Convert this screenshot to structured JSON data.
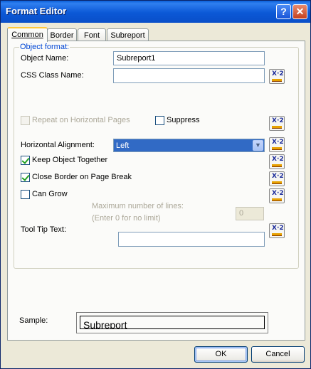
{
  "window": {
    "title": "Format Editor",
    "help_label": "?",
    "close_label": "✕"
  },
  "tabs": [
    {
      "label": "Common",
      "active": true
    },
    {
      "label": "Border",
      "active": false
    },
    {
      "label": "Font",
      "active": false
    },
    {
      "label": "Subreport",
      "active": false
    }
  ],
  "group": {
    "title": "Object format:"
  },
  "fields": {
    "object_name": {
      "label": "Object Name:",
      "value": "Subreport1"
    },
    "css_class": {
      "label": "CSS Class Name:",
      "value": ""
    },
    "repeat_horizontal": {
      "label": "Repeat on Horizontal Pages",
      "checked": false,
      "enabled": false
    },
    "suppress": {
      "label": "Suppress",
      "checked": false
    },
    "horizontal_alignment": {
      "label": "Horizontal Alignment:",
      "value": "Left"
    },
    "keep_together": {
      "label": "Keep Object Together",
      "checked": true
    },
    "close_border": {
      "label": "Close Border on Page Break",
      "checked": true
    },
    "can_grow": {
      "label": "Can Grow",
      "checked": false
    },
    "max_lines": {
      "label1": "Maximum number of lines:",
      "label2": "(Enter 0 for no limit)",
      "value": "0"
    },
    "tooltip": {
      "label": "Tool Tip Text:",
      "value": ""
    }
  },
  "formula_button": {
    "icon": "formula-x2-icon",
    "text": "X·2"
  },
  "sample": {
    "label": "Sample:",
    "text": "Subreport"
  },
  "buttons": {
    "ok": "OK",
    "cancel": "Cancel"
  },
  "colors": {
    "title_bar": "#0a58d6",
    "selection": "#316ac5",
    "group_title": "#0046d5",
    "check": "#21a121"
  }
}
